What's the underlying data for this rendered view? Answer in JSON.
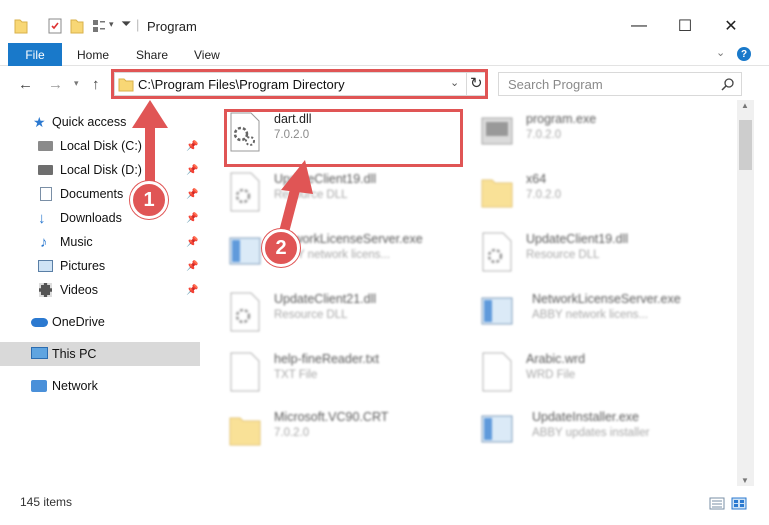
{
  "window": {
    "title": "Program",
    "minimize": "—",
    "maximize": "☐",
    "close": "✕"
  },
  "ribbon": {
    "file": "File",
    "tabs": [
      "Home",
      "Share",
      "View"
    ]
  },
  "address": {
    "path": "C:\\Program Files\\Program Directory",
    "search_placeholder": "Search Program"
  },
  "nav": {
    "items": [
      {
        "label": "Quick access",
        "icon": "star-icon",
        "pinned": false
      },
      {
        "label": "Local Disk (C:)",
        "icon": "drive-icon",
        "pinned": true
      },
      {
        "label": "Local Disk (D:)",
        "icon": "drive-icon",
        "pinned": true
      },
      {
        "label": "Documents",
        "icon": "documents-icon",
        "pinned": true
      },
      {
        "label": "Downloads",
        "icon": "download-icon",
        "pinned": true
      },
      {
        "label": "Music",
        "icon": "music-icon",
        "pinned": true
      },
      {
        "label": "Pictures",
        "icon": "pictures-icon",
        "pinned": true
      },
      {
        "label": "Videos",
        "icon": "videos-icon",
        "pinned": true
      },
      {
        "label": "OneDrive",
        "icon": "cloud-icon",
        "pinned": false
      },
      {
        "label": "This PC",
        "icon": "computer-icon",
        "pinned": false
      },
      {
        "label": "Network",
        "icon": "network-icon",
        "pinned": false
      }
    ]
  },
  "files": [
    {
      "name": "dart.dll",
      "sub": "7.0.2.0",
      "type": "dll",
      "highlight": true
    },
    {
      "name": "program.exe",
      "sub": "7.0.2.0",
      "type": "exe"
    },
    {
      "name": "UpdateClient19.dll",
      "sub": "Resource DLL",
      "type": "dll"
    },
    {
      "name": "x64",
      "sub": "7.0.2.0",
      "type": "folder"
    },
    {
      "name": "NetworkLicenseServer.exe",
      "sub": "ABBY network licens...",
      "type": "exe"
    },
    {
      "name": "UpdateClient19.dll",
      "sub": "Resource DLL",
      "type": "dll"
    },
    {
      "name": "UpdateClient21.dll",
      "sub": "Resource DLL",
      "type": "dll"
    },
    {
      "name": "NetworkLicenseServer.exe",
      "sub": "ABBY network licens...",
      "type": "exe"
    },
    {
      "name": "help-fineReader.txt",
      "sub": "TXT File",
      "type": "txt"
    },
    {
      "name": "Arabic.wrd",
      "sub": "WRD File",
      "type": "txt"
    },
    {
      "name": "Microsoft.VC90.CRT",
      "sub": "7.0.2.0",
      "type": "folder"
    },
    {
      "name": "UpdateInstaller.exe",
      "sub": "ABBY updates installer",
      "type": "exe"
    }
  ],
  "status": {
    "count": "145 items"
  },
  "annotations": {
    "badge1": "1",
    "badge2": "2"
  },
  "colors": {
    "accent": "#1979ca",
    "highlight": "#e05555"
  }
}
